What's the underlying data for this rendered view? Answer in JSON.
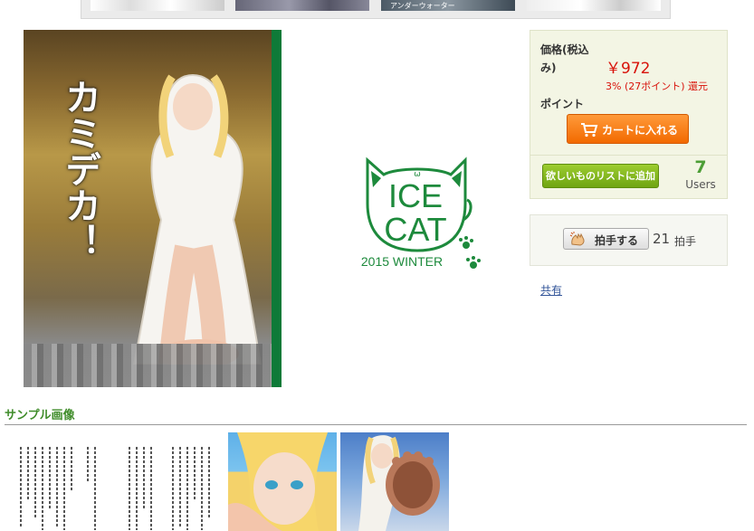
{
  "top_strip": {
    "thumb_caption": "アンダーウォーター"
  },
  "product": {
    "cover_title": "カミデカ！",
    "circle_logo": {
      "line1": "ICE",
      "line2": "CAT",
      "line3": "2015 WINTER",
      "face": "ω"
    }
  },
  "purchase": {
    "price_label": "価格(税込み)",
    "price": "￥972",
    "point_label": "ポイント",
    "point_value": "3% (27ポイント) 還元",
    "cart_button": "カートに入れる",
    "wishlist_button": "欲しいものリストに追加",
    "wishlist_count": "7",
    "wishlist_unit": "Users"
  },
  "applause": {
    "button_label": "拍手する",
    "count": "21",
    "unit": "拍手"
  },
  "share": {
    "label": "共有"
  },
  "samples": {
    "heading": "サンプル画像"
  },
  "colors": {
    "price_red": "#d8120a",
    "cart_orange": "#f26a00",
    "wishlist_green": "#6fa512",
    "logo_green": "#1d8a3c",
    "heading_green": "#3f8c2a"
  }
}
